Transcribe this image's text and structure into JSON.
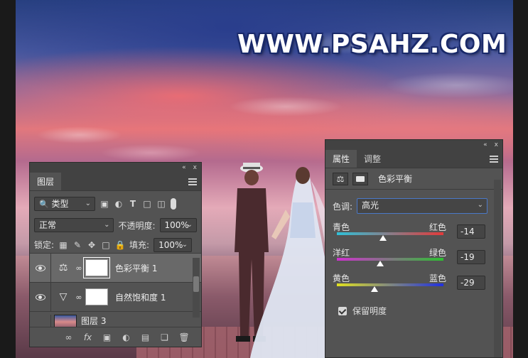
{
  "watermark": "WWW.PSAHZ.COM",
  "layers_panel": {
    "topbar_collapse": "«",
    "topbar_close": "x",
    "tab": "图层",
    "kind_filter": "类型",
    "blend_mode": "正常",
    "opacity_label": "不透明度:",
    "opacity_value": "100%",
    "lock_label": "锁定:",
    "fill_label": "填充:",
    "fill_value": "100%",
    "layers": [
      {
        "name": "色彩平衡 1",
        "icon": "balance-icon",
        "selected": true
      },
      {
        "name": "自然饱和度 1",
        "icon": "vibrance-icon",
        "selected": false
      },
      {
        "name": "图层 3",
        "icon": "image-thumbnail",
        "selected": false
      }
    ],
    "footer_fx": "fx"
  },
  "properties_panel": {
    "topbar_collapse": "«",
    "topbar_close": "x",
    "tabs": [
      {
        "label": "属性",
        "active": true
      },
      {
        "label": "调整",
        "active": false
      }
    ],
    "title": "色彩平衡",
    "tone_label": "色调:",
    "tone_value": "高光",
    "sliders": [
      {
        "left": "青色",
        "right": "红色",
        "value": "-14",
        "position": -14,
        "colors": [
          "#2fc0d8",
          "#e23a3a"
        ]
      },
      {
        "left": "洋红",
        "right": "绿色",
        "value": "-19",
        "position": -19,
        "colors": [
          "#d030d0",
          "#2cc030"
        ]
      },
      {
        "left": "黄色",
        "right": "蓝色",
        "value": "-29",
        "position": -29,
        "colors": [
          "#e0e020",
          "#2030e0"
        ]
      }
    ],
    "preserve_label": "保留明度",
    "preserve_checked": true
  }
}
